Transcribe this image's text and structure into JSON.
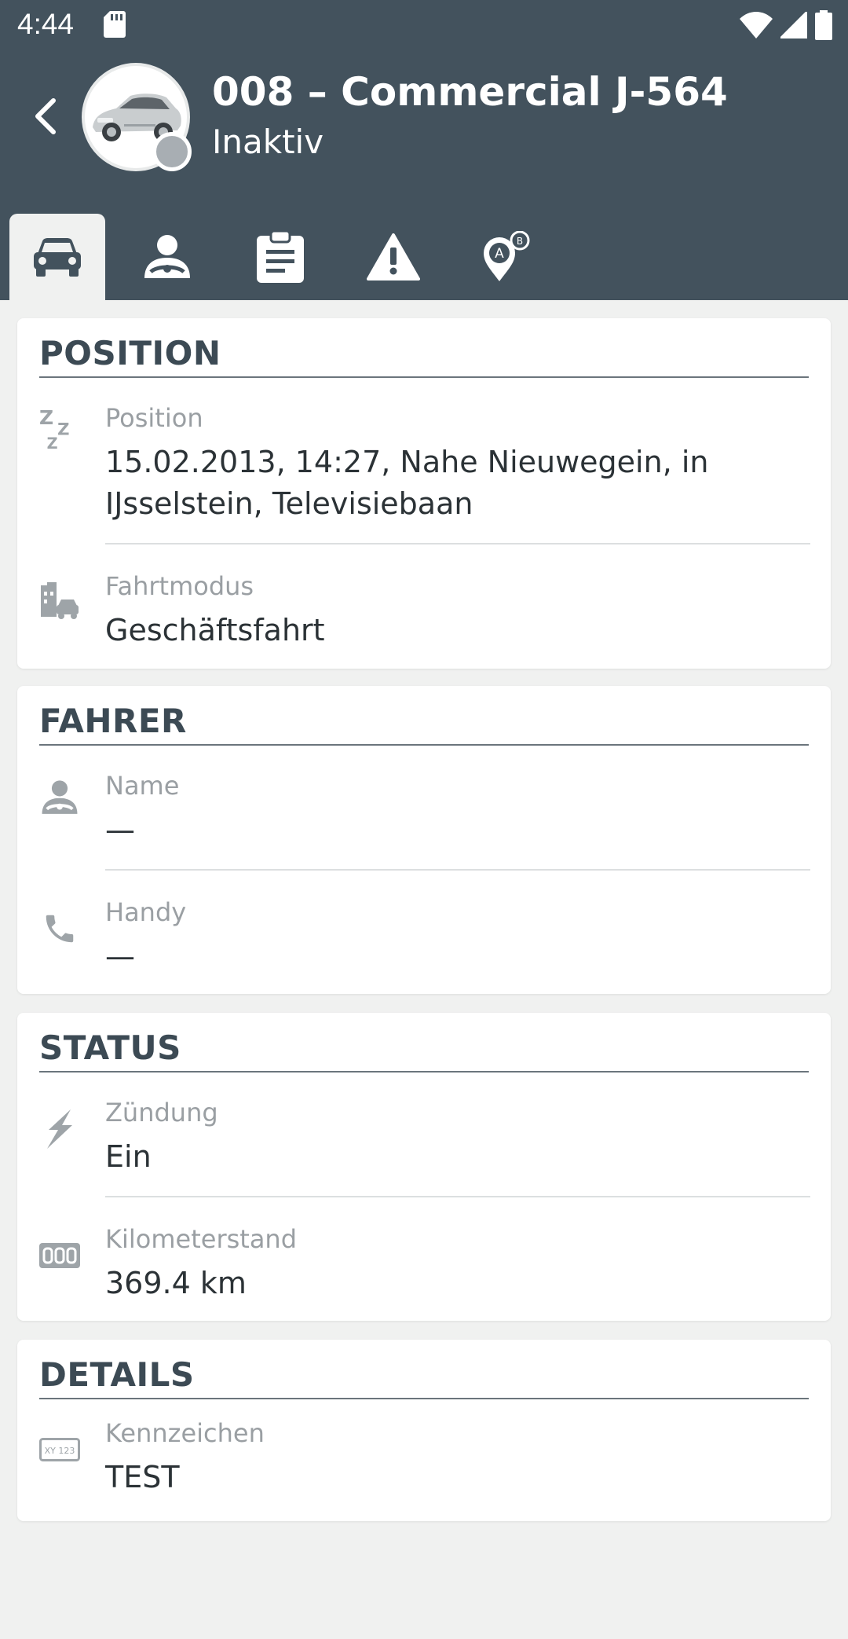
{
  "statusbar": {
    "time": "4:44"
  },
  "header": {
    "title": "008 – Commercial J-564",
    "status": "Inaktiv",
    "status_color": "#a8aeb3",
    "background": "#43525d"
  },
  "tabs": [
    {
      "icon": "car-icon",
      "active": true
    },
    {
      "icon": "driver-icon",
      "active": false
    },
    {
      "icon": "clipboard-icon",
      "active": false
    },
    {
      "icon": "warning-icon",
      "active": false
    },
    {
      "icon": "route-pin-icon",
      "active": false
    }
  ],
  "sections": {
    "position": {
      "title": "POSITION",
      "rows": [
        {
          "icon": "sleep-icon",
          "label": "Position",
          "value": "15.02.2013, 14:27, Nahe Nieuwegein, in IJsselstein, Televisiebaan"
        },
        {
          "icon": "business-car-icon",
          "label": "Fahrtmodus",
          "value": "Geschäftsfahrt"
        }
      ]
    },
    "driver": {
      "title": "FAHRER",
      "rows": [
        {
          "icon": "driver-icon",
          "label": "Name",
          "value": "—"
        },
        {
          "icon": "phone-icon",
          "label": "Handy",
          "value": "—"
        }
      ]
    },
    "status": {
      "title": "STATUS",
      "rows": [
        {
          "icon": "ignition-icon",
          "label": "Zündung",
          "value": "Ein"
        },
        {
          "icon": "odometer-icon",
          "label": "Kilometerstand",
          "value": "369.4 km"
        }
      ]
    },
    "details": {
      "title": "DETAILS",
      "rows": [
        {
          "icon": "license-plate-icon",
          "label": "Kennzeichen",
          "value": "TEST",
          "plate_text": "XY 123"
        }
      ]
    }
  }
}
